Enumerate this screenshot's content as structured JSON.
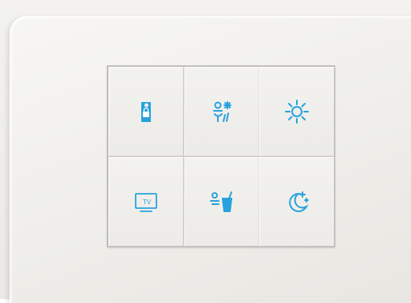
{
  "device": {
    "accent_color": "#27a2de",
    "keys": [
      {
        "icon": "do-not-disturb-icon"
      },
      {
        "icon": "housekeeping-icon"
      },
      {
        "icon": "sun-icon"
      },
      {
        "icon": "tv-icon",
        "label": "TV"
      },
      {
        "icon": "minibar-icon"
      },
      {
        "icon": "night-mode-icon"
      }
    ]
  }
}
